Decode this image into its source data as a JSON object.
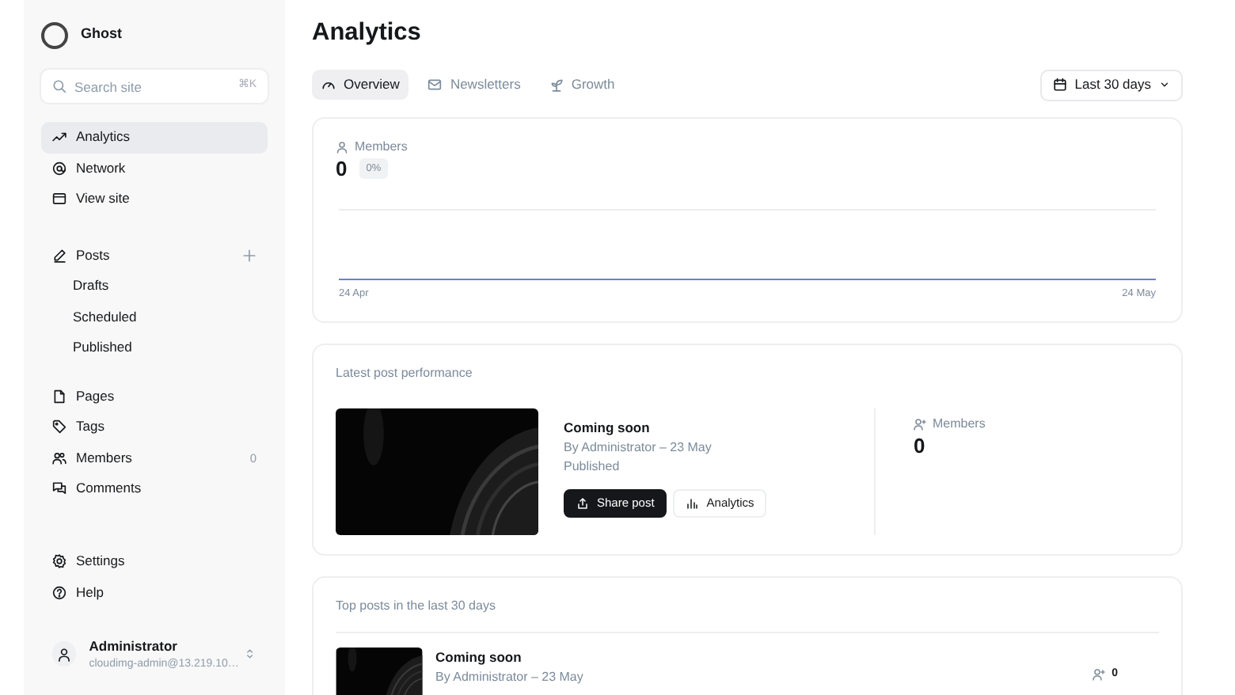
{
  "sidebar": {
    "site_name": "Ghost",
    "search": {
      "placeholder": "Search site",
      "shortcut": "⌘K"
    },
    "nav": [
      {
        "label": "Analytics",
        "kind": "trend",
        "selected": true
      },
      {
        "label": "Network",
        "kind": "at",
        "selected": false
      },
      {
        "label": "View site",
        "kind": "window",
        "selected": false
      }
    ],
    "posts": {
      "label": "Posts",
      "kind": "pen",
      "selected": false,
      "children": [
        {
          "label": "Drafts",
          "selected": false
        },
        {
          "label": "Scheduled",
          "selected": false
        },
        {
          "label": "Published",
          "selected": false
        }
      ]
    },
    "sections": [
      {
        "label": "Pages",
        "kind": "page",
        "selected": false
      },
      {
        "label": "Tags",
        "kind": "tag",
        "selected": false
      },
      {
        "label": "Members",
        "kind": "people",
        "selected": false,
        "count": "0"
      },
      {
        "label": "Comments",
        "kind": "chat",
        "selected": false
      }
    ],
    "footer_nav": [
      {
        "label": "Settings",
        "kind": "gear",
        "selected": false
      },
      {
        "label": "Help",
        "kind": "help",
        "selected": false
      }
    ],
    "user": {
      "name": "Administrator",
      "email": "cloudimg-admin@13.219.10…"
    }
  },
  "main": {
    "title": "Analytics",
    "tabs": [
      {
        "label": "Overview",
        "kind": "gauge",
        "selected": true
      },
      {
        "label": "Newsletters",
        "kind": "mail",
        "selected": false
      },
      {
        "label": "Growth",
        "kind": "sprout",
        "selected": false
      }
    ],
    "date_filter": "Last 30 days",
    "members_card": {
      "label": "Members",
      "value": "0",
      "change": "0%",
      "axis_labels": [
        "24 Apr",
        "24 May"
      ]
    },
    "latest_post": {
      "heading": "Latest post performance",
      "title": "Coming soon",
      "byline": "By Administrator – 23 May",
      "status": "Published",
      "actions": [
        {
          "label": "Share post",
          "kind": "primary"
        },
        {
          "label": "Analytics",
          "kind": "secondary"
        }
      ],
      "stat": {
        "label": "Members",
        "value": "0"
      }
    },
    "top_posts": {
      "heading": "Top posts in the last 30 days",
      "rows": [
        {
          "title": "Coming soon",
          "byline": "By Administrator – 23 May",
          "members": "0"
        }
      ]
    }
  }
}
